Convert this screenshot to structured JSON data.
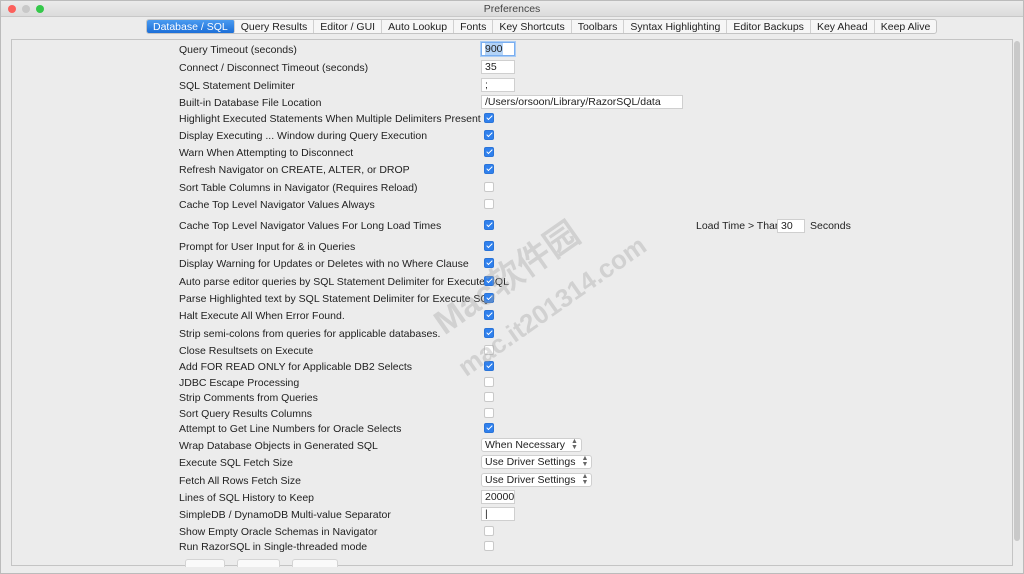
{
  "window": {
    "title": "Preferences"
  },
  "tabs": [
    {
      "label": "Database / SQL",
      "active": true
    },
    {
      "label": "Query Results"
    },
    {
      "label": "Editor / GUI"
    },
    {
      "label": "Auto Lookup"
    },
    {
      "label": "Fonts"
    },
    {
      "label": "Key Shortcuts"
    },
    {
      "label": "Toolbars"
    },
    {
      "label": "Syntax Highlighting"
    },
    {
      "label": "Editor Backups"
    },
    {
      "label": "Key Ahead"
    },
    {
      "label": "Keep Alive"
    }
  ],
  "settings": [
    {
      "label": "Query Timeout (seconds)",
      "type": "text",
      "value": "900",
      "width": 34,
      "focus": true
    },
    {
      "label": "Connect / Disconnect Timeout (seconds)",
      "type": "text",
      "value": "35",
      "width": 34
    },
    {
      "label": "SQL Statement Delimiter",
      "type": "text",
      "value": ";",
      "width": 34
    },
    {
      "label": "Built-in Database File Location",
      "type": "text",
      "value": "/Users/orsoon/Library/RazorSQL/data",
      "width": 202
    },
    {
      "label": "Highlight Executed Statements When Multiple Delimiters Present",
      "type": "checkbox",
      "checked": true
    },
    {
      "label": "Display Executing ... Window during Query Execution",
      "type": "checkbox",
      "checked": true
    },
    {
      "label": "Warn When Attempting to Disconnect",
      "type": "checkbox",
      "checked": true
    },
    {
      "label": "Refresh Navigator on CREATE, ALTER, or DROP",
      "type": "checkbox",
      "checked": true
    },
    {
      "label": "Sort Table Columns in Navigator (Requires Reload)",
      "type": "checkbox",
      "checked": false
    },
    {
      "label": "Cache Top Level Navigator Values Always",
      "type": "checkbox",
      "checked": false
    },
    {
      "label": "Cache Top Level Navigator Values For Long Load Times",
      "type": "checkbox",
      "checked": true,
      "extra": {
        "label": "Load Time > Than",
        "value": "30",
        "suffix": "Seconds"
      }
    },
    {
      "label": "Prompt for User Input for & in Queries",
      "type": "checkbox",
      "checked": true
    },
    {
      "label": "Display Warning for Updates or Deletes with no Where Clause",
      "type": "checkbox",
      "checked": true
    },
    {
      "label": "Auto parse editor queries by SQL Statement Delimiter for Execute SQL",
      "type": "checkbox",
      "checked": true
    },
    {
      "label": "Parse Highlighted text by SQL Statement Delimiter for Execute SQL",
      "type": "checkbox",
      "checked": true
    },
    {
      "label": "Halt Execute All When Error Found.",
      "type": "checkbox",
      "checked": true
    },
    {
      "label": "Strip semi-colons from queries for applicable databases.",
      "type": "checkbox",
      "checked": true
    },
    {
      "label": "Close Resultsets on Execute",
      "type": "checkbox",
      "checked": false
    },
    {
      "label": "Add FOR READ ONLY for Applicable DB2 Selects",
      "type": "checkbox",
      "checked": true
    },
    {
      "label": "JDBC Escape Processing",
      "type": "checkbox",
      "checked": false
    },
    {
      "label": "Strip Comments from Queries",
      "type": "checkbox",
      "checked": false
    },
    {
      "label": "Sort Query Results Columns",
      "type": "checkbox",
      "checked": false
    },
    {
      "label": "Attempt to Get Line Numbers for Oracle Selects",
      "type": "checkbox",
      "checked": true
    },
    {
      "label": "Wrap Database Objects in Generated SQL",
      "type": "select",
      "value": "When Necessary"
    },
    {
      "label": "Execute SQL Fetch Size",
      "type": "select",
      "value": "Use Driver Settings"
    },
    {
      "label": "Fetch All Rows Fetch Size",
      "type": "select",
      "value": "Use Driver Settings"
    },
    {
      "label": "Lines of SQL History to Keep",
      "type": "text",
      "value": "20000",
      "width": 34
    },
    {
      "label": "SimpleDB / DynamoDB Multi-value Separator",
      "type": "text",
      "value": "|",
      "width": 34
    },
    {
      "label": "Show Empty Oracle Schemas in Navigator",
      "type": "checkbox",
      "checked": false
    },
    {
      "label": "Run RazorSQL in Single-threaded mode",
      "type": "checkbox",
      "checked": false
    }
  ],
  "watermark": {
    "line1": "Mac软件园",
    "line2": "mac.it201314.com"
  },
  "colors": {
    "accent": "#2f80ed",
    "close": "#fc605c",
    "minimize": "#fdbc40",
    "zoom": "#34c84a"
  }
}
